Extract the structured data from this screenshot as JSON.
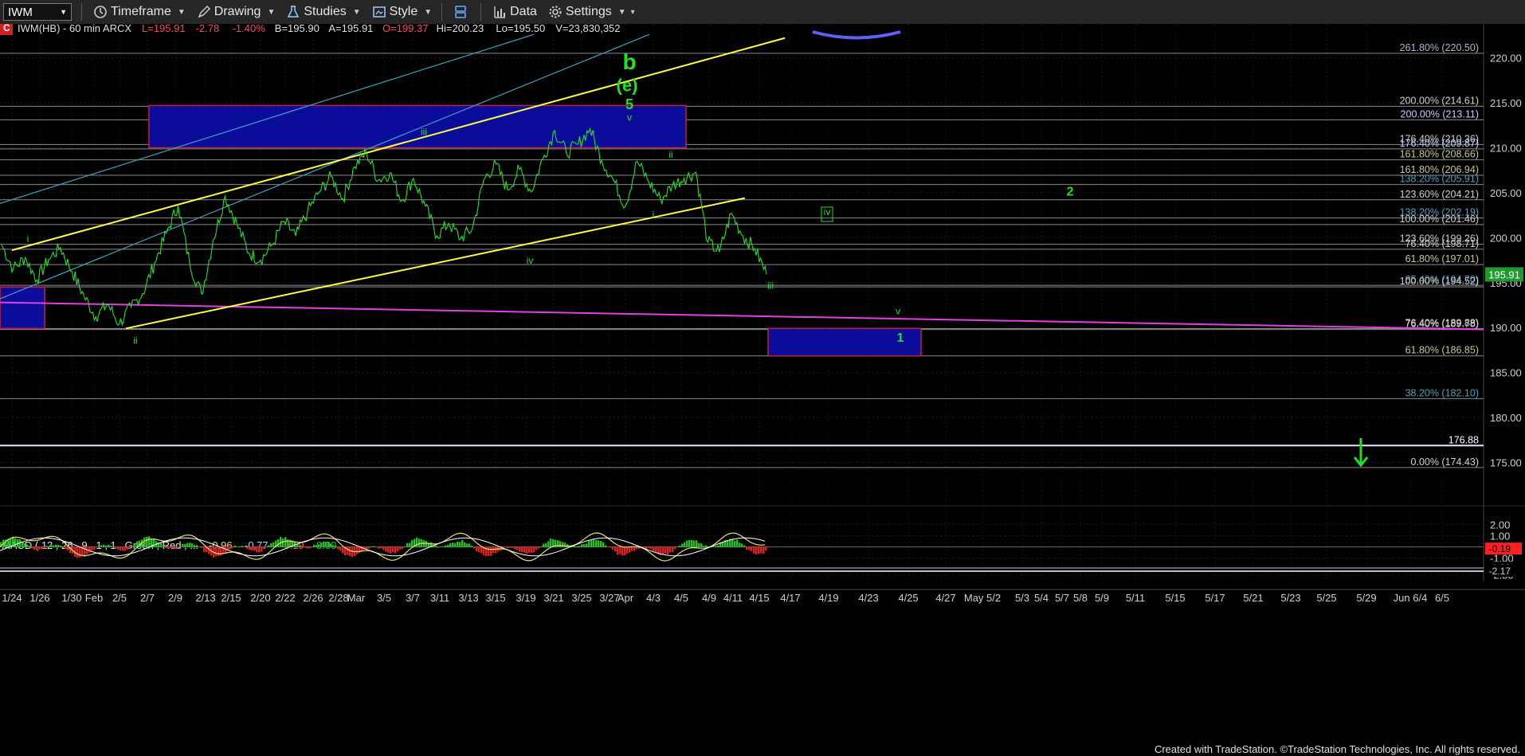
{
  "toolbar": {
    "symbol": "IWM",
    "items": [
      {
        "label": "Timeframe",
        "icon": "clock-icon"
      },
      {
        "label": "Drawing",
        "icon": "pencil-icon"
      },
      {
        "label": "Studies",
        "icon": "flask-icon"
      },
      {
        "label": "Style",
        "icon": "style-icon"
      },
      {
        "label": "",
        "icon": "layout-icon"
      },
      {
        "label": "Data",
        "icon": "bar-chart-icon"
      },
      {
        "label": "Settings",
        "icon": "gear-icon"
      }
    ]
  },
  "header": {
    "badge": "C",
    "symbol_info": "IWM(HB) - 60 min  ARCX",
    "fields": [
      {
        "text": "L=195.91",
        "color": "#ff4a4a"
      },
      {
        "text": "-2.78",
        "color": "#ff4a4a"
      },
      {
        "text": "-1.40%",
        "color": "#ff4a4a"
      },
      {
        "text": "B=195.90",
        "color": "#e0e0e0"
      },
      {
        "text": "A=195.91",
        "color": "#e0e0e0"
      },
      {
        "text": "O=199.37",
        "color": "#ff4a4a"
      },
      {
        "text": "Hi=200.23",
        "color": "#e0e0e0"
      },
      {
        "text": "Lo=195.50",
        "color": "#e0e0e0"
      },
      {
        "text": "V=23,830,352",
        "color": "#e0e0e0"
      }
    ]
  },
  "macd": {
    "title": "MACD ( 12 , 26 , 9 , 1 , 1 , Green , Red , ...",
    "values": [
      {
        "text": "-0.96",
        "color": "#e8e070"
      },
      {
        "text": "-0.77",
        "color": "#9fd0ff"
      },
      {
        "text": "-0.19",
        "color": "#ff4a4a"
      },
      {
        "text": "0.00",
        "color": "#30c030"
      }
    ],
    "axis_ticks": [
      2.0,
      1.0,
      -1.0,
      -2.5
    ],
    "axis_labels": [
      "2.00",
      "1.00",
      "-1.00",
      "-2.50"
    ],
    "tags": [
      {
        "value": -0.19,
        "text": "-0.19",
        "fill": "#ff2020"
      },
      {
        "value": -1.89,
        "text": "-1.89",
        "fill": "#000"
      },
      {
        "value": -2.17,
        "text": "-2.17",
        "fill": "#000"
      }
    ]
  },
  "colors": {
    "price": "#22e022",
    "channel": "#ffff40",
    "magenta_line": "#e040e0",
    "cyan_line": "#40a0c0",
    "target_box_fill": "#0c0c9a",
    "target_box_border": "#c02040",
    "wave_label": "#22e022"
  },
  "chart_data": {
    "type": "line",
    "title": "",
    "xlabel": "",
    "ylabel": "",
    "ylim": [
      171.5,
      222
    ],
    "y_ticks": [
      175,
      180,
      185,
      190,
      195,
      200,
      205,
      210,
      215,
      220
    ],
    "y_tick_labels": [
      "175.00",
      "180.00",
      "185.00",
      "190.00",
      "195.00",
      "200.00",
      "205.00",
      "210.00",
      "215.00",
      "220.00"
    ],
    "x_tick_labels": [
      "1/24",
      "1/26",
      "1/30",
      "Feb",
      "2/5",
      "2/7",
      "2/9",
      "2/13",
      "2/15",
      "2/20",
      "2/22",
      "2/26",
      "2/28",
      "Mar",
      "3/5",
      "3/7",
      "3/11",
      "3/13",
      "3/15",
      "3/19",
      "3/21",
      "3/25",
      "3/27",
      "Apr",
      "4/3",
      "4/5",
      "4/9",
      "4/11",
      "4/15",
      "4/17",
      "4/19",
      "4/23",
      "4/25",
      "4/27",
      "May 5/2",
      "5/3",
      "5/4",
      "5/7",
      "5/8",
      "5/9",
      "5/11",
      "5/15",
      "5/17",
      "5/21",
      "5/23",
      "5/25",
      "5/29",
      "Jun 6/4",
      "6/5"
    ],
    "last_price": {
      "value": 195.91,
      "text": "195.91"
    },
    "series": [
      {
        "values": [
          199.2,
          196.5,
          197.8,
          195.3,
          197.6,
          198.9,
          196.2,
          193.5,
          191.2,
          192.6,
          190.4,
          192.3,
          193.8,
          197.2,
          200.5,
          203.6,
          197.0,
          193.7,
          199.8,
          204.6,
          201.5,
          198.3,
          197.5,
          199.2,
          201.8,
          200.2,
          202.9,
          205.1,
          206.8,
          204.3,
          207.9,
          209.5,
          206.4,
          207.2,
          204.1,
          206.6,
          203.5,
          200.2,
          201.6,
          199.9,
          201.0,
          206.5,
          208.2,
          205.3,
          207.6,
          205.1,
          208.8,
          211.9,
          209.4,
          210.4,
          212.1,
          208.6,
          206.4,
          203.5,
          208.5,
          206.2,
          204.2,
          205.8,
          206.6,
          207.3,
          199.5,
          198.4,
          202.7,
          200.2,
          198.8,
          195.91
        ]
      }
    ],
    "fib_levels": [
      {
        "value": 220.5,
        "text": "261.80% (220.50)",
        "color": "#aab8c8"
      },
      {
        "value": 214.61,
        "text": "200.00% (214.61)",
        "color": "#d0d0d0"
      },
      {
        "value": 213.11,
        "text": "200.00% (213.11)",
        "color": "#c0d0ff"
      },
      {
        "value": 210.36,
        "text": "176.40% (210.36)",
        "color": "#d0d0d0"
      },
      {
        "value": 209.87,
        "text": "176.40% (209.87)",
        "color": "#c0d0ff"
      },
      {
        "value": 208.66,
        "text": "161.80% (208.66)",
        "color": "#c8c890"
      },
      {
        "value": 206.94,
        "text": "161.80% (206.94)",
        "color": "#c8c890"
      },
      {
        "value": 205.91,
        "text": "138.20% (205.91)",
        "color": "#50a0b8"
      },
      {
        "value": 204.21,
        "text": "123.60% (204.21)",
        "color": "#d0d0d0"
      },
      {
        "value": 202.19,
        "text": "138.20% (202.19)",
        "color": "#50a0b8"
      },
      {
        "value": 201.46,
        "text": "100.00% (201.46)",
        "color": "#d0d0d0"
      },
      {
        "value": 199.26,
        "text": "123.60% (199.26)",
        "color": "#d0d0d0"
      },
      {
        "value": 198.71,
        "text": "76.40% (198.71)",
        "color": "#d0d0d0"
      },
      {
        "value": 197.01,
        "text": "61.80% (197.01)",
        "color": "#c8c890"
      },
      {
        "value": 194.7,
        "text": "85.40% (194.70)",
        "color": "#50a0b8"
      },
      {
        "value": 194.52,
        "text": "100.00% (194.52)",
        "color": "#d0d0d0"
      },
      {
        "value": 189.88,
        "text": "76.40% (189.88)",
        "color": "#d0d0d0"
      },
      {
        "value": 189.78,
        "text": "76.40% (189.78)",
        "color": "#d0d0d0"
      },
      {
        "value": 186.85,
        "text": "61.80% (186.85)",
        "color": "#c8c890"
      },
      {
        "value": 182.1,
        "text": "38.20% (182.10)",
        "color": "#50a0b8"
      },
      {
        "value": 176.88,
        "text": "176.88",
        "color": "#ffffff"
      },
      {
        "value": 174.43,
        "text": "0.00% (174.43)",
        "color": "#d0d0d0"
      }
    ],
    "wave_labels": [
      {
        "text": "i",
        "x": 35,
        "y": 199.5
      },
      {
        "text": "ii",
        "x": 170,
        "y": 188.2
      },
      {
        "text": "iii",
        "x": 532,
        "y": 211.4
      },
      {
        "text": "iv",
        "x": 665,
        "y": 197.1
      },
      {
        "text": "v",
        "x": 790,
        "y": 213.0
      },
      {
        "text": "5",
        "x": 790,
        "y": 214.3
      },
      {
        "text": "(e)",
        "x": 787,
        "y": 216.3
      },
      {
        "text": "b",
        "x": 790,
        "y": 218.7
      },
      {
        "text": "ii",
        "x": 842,
        "y": 208.9
      },
      {
        "text": "i",
        "x": 820,
        "y": 202.2
      },
      {
        "text": "iii",
        "x": 967,
        "y": 194.3
      },
      {
        "text": "iv",
        "x": 1038,
        "y": 202.5
      },
      {
        "text": "v",
        "x": 1127,
        "y": 191.5
      },
      {
        "text": "1",
        "x": 1130,
        "y": 188.4
      },
      {
        "text": "2",
        "x": 1343,
        "y": 204.7
      }
    ]
  }
}
